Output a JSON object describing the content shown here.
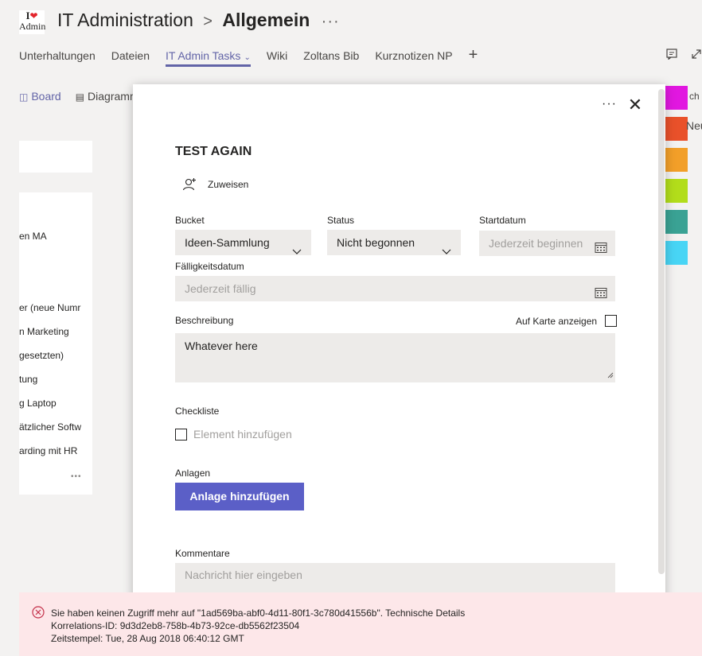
{
  "header": {
    "logo": {
      "line1": "I",
      "line2": "Admin"
    },
    "team_name": "IT Administration",
    "separator": ">",
    "channel_name": "Allgemein",
    "more": "···"
  },
  "tabs": [
    {
      "label": "Unterhaltungen"
    },
    {
      "label": "Dateien"
    },
    {
      "label": "IT Admin Tasks",
      "active": true
    },
    {
      "label": "Wiki"
    },
    {
      "label": "Zoltans Bib"
    },
    {
      "label": "Kurznotizen NP"
    }
  ],
  "tab_add": "+",
  "view_tabs": [
    {
      "label": "Board",
      "icon": "board-icon"
    },
    {
      "label": "Diagramm",
      "icon": "chart-icon"
    }
  ],
  "background_list": [
    "en MA",
    "er (neue Numr",
    "n Marketing",
    "gesetzten)",
    "tung",
    "g Laptop",
    "ätzlicher Softw",
    "arding mit HR"
  ],
  "background_list_more": "•••",
  "right_swatches": {
    "colors": [
      "#e117e0",
      "#e9512a",
      "#f29f29",
      "#b2dd1b",
      "#3aa294",
      "#48d5f5"
    ],
    "labels": [
      "ch",
      "Neu"
    ]
  },
  "dialog": {
    "more": "···",
    "close": "✕",
    "title": "TEST AGAIN",
    "assign_label": "Zuweisen",
    "bucket_label": "Bucket",
    "bucket_value": "Ideen-Sammlung",
    "status_label": "Status",
    "status_value": "Nicht begonnen",
    "start_label": "Startdatum",
    "start_placeholder": "Jederzeit beginnen",
    "due_label": "Fälligkeitsdatum",
    "due_placeholder": "Jederzeit fällig",
    "description_label": "Beschreibung",
    "show_on_card_label": "Auf Karte anzeigen",
    "description_value": "Whatever here",
    "checklist_label": "Checkliste",
    "checklist_placeholder": "Element hinzufügen",
    "attachments_label": "Anlagen",
    "attach_button": "Anlage hinzufügen",
    "comments_label": "Kommentare",
    "comment_placeholder": "Nachricht hier eingeben"
  },
  "error": {
    "line1": "Sie haben keinen Zugriff mehr auf \"1ad569ba-abf0-4d11-80f1-3c780d41556b\". Technische Details",
    "line2": "Korrelations-ID: 9d3d2eb8-758b-4b73-92ce-db5562f23504",
    "line3": "Zeitstempel: Tue, 28 Aug 2018 06:40:12 GMT",
    "color": "#c4314b"
  }
}
